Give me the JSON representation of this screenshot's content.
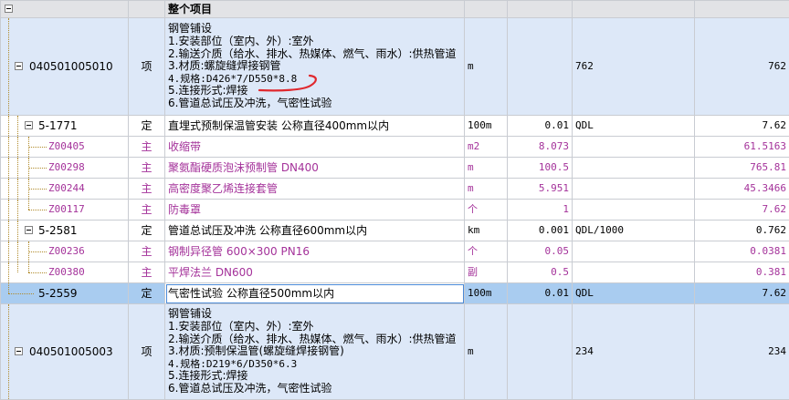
{
  "header": {
    "title": "整个项目"
  },
  "rows": [
    {
      "code": "040501005010",
      "type": "项",
      "unit": "m",
      "qty": "",
      "expr": "762",
      "amount": "762",
      "desc": [
        "钢管铺设",
        "1.安装部位（室内、外）:室外",
        "2.输送介质（给水、排水、热媒体、燃气、雨水）:供热管道",
        "3.材质:螺旋缝焊接钢管",
        "4.规格:D426*7/D550*8.8",
        "5.连接形式:焊接",
        "6.管道总试压及冲洗，气密性试验"
      ]
    },
    {
      "code": "5-1771",
      "type": "定",
      "name": "直埋式预制保温管安装 公称直径400mm以内",
      "unit": "100m",
      "qty": "0.01",
      "expr": "QDL",
      "amount": "7.62"
    },
    {
      "code": "Z00405",
      "type": "主",
      "name": "收缩带",
      "unit": "m2",
      "qty": "8.073",
      "expr": "",
      "amount": "61.5163"
    },
    {
      "code": "Z00298",
      "type": "主",
      "name": "聚氨酯硬质泡沫预制管 DN400",
      "unit": "m",
      "qty": "100.5",
      "expr": "",
      "amount": "765.81"
    },
    {
      "code": "Z00244",
      "type": "主",
      "name": "高密度聚乙烯连接套管",
      "unit": "m",
      "qty": "5.951",
      "expr": "",
      "amount": "45.3466"
    },
    {
      "code": "Z00117",
      "type": "主",
      "name": "防毒罩",
      "unit": "个",
      "qty": "1",
      "expr": "",
      "amount": "7.62"
    },
    {
      "code": "5-2581",
      "type": "定",
      "name": "管道总试压及冲洗 公称直径600mm以内",
      "unit": "km",
      "qty": "0.001",
      "expr": "QDL/1000",
      "amount": "0.762"
    },
    {
      "code": "Z00236",
      "type": "主",
      "name": "钢制异径管 600×300 PN16",
      "unit": "个",
      "qty": "0.05",
      "expr": "",
      "amount": "0.0381"
    },
    {
      "code": "Z00380",
      "type": "主",
      "name": "平焊法兰 DN600",
      "unit": "副",
      "qty": "0.5",
      "expr": "",
      "amount": "0.381"
    },
    {
      "code": "5-2559",
      "type": "定",
      "name": "气密性试验 公称直径500mm以内",
      "unit": "100m",
      "qty": "0.01",
      "expr": "QDL",
      "amount": "7.62"
    },
    {
      "code": "040501005003",
      "type": "项",
      "unit": "m",
      "qty": "",
      "expr": "234",
      "amount": "234",
      "desc": [
        "钢管铺设",
        "1.安装部位（室内、外）:室外",
        "2.输送介质（给水、排水、热媒体、燃气、雨水）:供热管道",
        "3.材质:预制保温管(螺旋缝焊接钢管)",
        "4.规格:D219*6/D350*6.3",
        "5.连接形式:焊接",
        "6.管道总试压及冲洗，气密性试验"
      ]
    }
  ]
}
